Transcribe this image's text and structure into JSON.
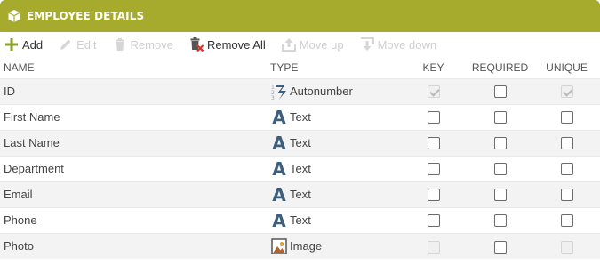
{
  "panel": {
    "title": "EMPLOYEE DETAILS"
  },
  "toolbar": {
    "add": "Add",
    "edit": "Edit",
    "remove": "Remove",
    "remove_all": "Remove All",
    "move_up": "Move up",
    "move_down": "Move down"
  },
  "columns": {
    "name": "NAME",
    "type": "TYPE",
    "key": "KEY",
    "required": "REQUIRED",
    "unique": "UNIQUE"
  },
  "rows": [
    {
      "name": "ID",
      "type": "Autonumber",
      "icon": "autonumber-icon",
      "key": "checked-disabled",
      "required": "unchecked",
      "unique": "checked-disabled"
    },
    {
      "name": "First Name",
      "type": "Text",
      "icon": "text-type-icon",
      "key": "unchecked",
      "required": "unchecked",
      "unique": "unchecked"
    },
    {
      "name": "Last Name",
      "type": "Text",
      "icon": "text-type-icon",
      "key": "unchecked",
      "required": "unchecked",
      "unique": "unchecked"
    },
    {
      "name": "Department",
      "type": "Text",
      "icon": "text-type-icon",
      "key": "unchecked",
      "required": "unchecked",
      "unique": "unchecked"
    },
    {
      "name": "Email",
      "type": "Text",
      "icon": "text-type-icon",
      "key": "unchecked",
      "required": "unchecked",
      "unique": "unchecked"
    },
    {
      "name": "Phone",
      "type": "Text",
      "icon": "text-type-icon",
      "key": "unchecked",
      "required": "unchecked",
      "unique": "unchecked"
    },
    {
      "name": "Photo",
      "type": "Image",
      "icon": "image-type-icon",
      "key": "unchecked-disabled",
      "required": "unchecked",
      "unique": "unchecked-disabled"
    }
  ],
  "colors": {
    "title_bar": "#a6ab2d",
    "add_icon": "#8aa12b",
    "text_icon": "#3d5f7d",
    "remove_all_x": "#d9342b"
  }
}
